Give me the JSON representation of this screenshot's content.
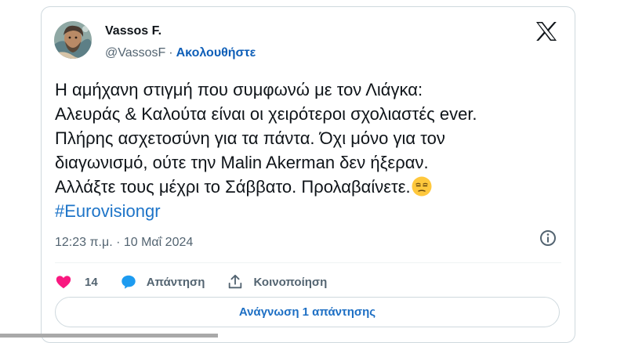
{
  "author": {
    "name": "Vassos F.",
    "handle": "@VassosF",
    "separator": "·",
    "follow_label": "Ακολουθήστε"
  },
  "icons": {
    "platform_logo": "x-logo-icon",
    "info": "info-icon",
    "like": "heart-icon",
    "reply": "speech-bubble-icon",
    "share": "share-upload-icon"
  },
  "tweet": {
    "lines": [
      "Η αμήχανη στιγμή που συμφωνώ με τον Λιάγκα:",
      "Αλευράς & Καλούτα είναι οι χειρότεροι σχολιαστές ever.",
      "Πλήρης ασχετοσύνη για τα πάντα. Όχι μόνο για τον",
      "διαγωνισμό, ούτε την Malin Akerman δεν ήξεραν.",
      "Αλλάξτε τους μέχρι το Σάββατο. Προλαβαίνετε."
    ],
    "emoji": "unamused-face-emoji",
    "hashtag": "#Eurovisiongr",
    "timestamp": "12:23 π.μ. · 10 Μαΐ 2024"
  },
  "actions": {
    "like_count": "14",
    "reply_label": "Απάντηση",
    "share_label": "Κοινοποίηση"
  },
  "read_replies_label": "Ανάγνωση 1 απάντησης",
  "colors": {
    "accent": "#1d74c8",
    "like": "#f91880",
    "reply_icon": "#1d9bf0",
    "muted": "#536471",
    "border": "#cfd9de"
  }
}
